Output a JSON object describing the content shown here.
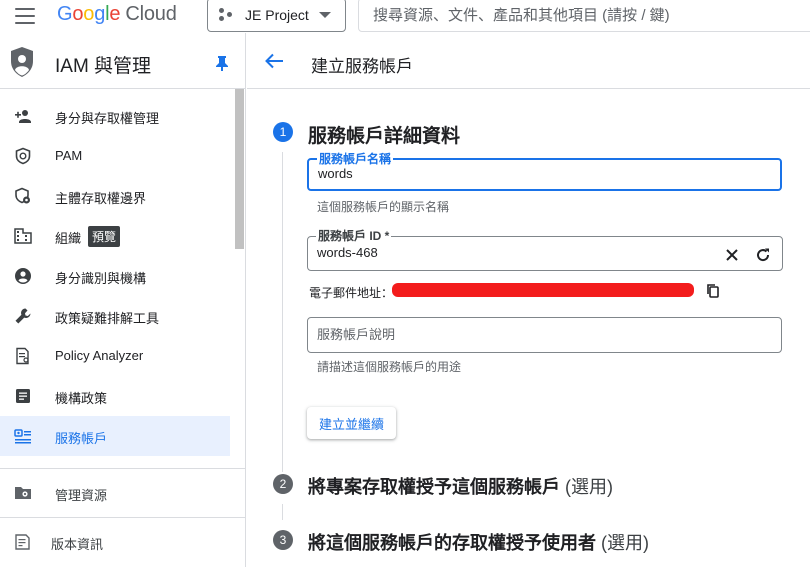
{
  "topbar": {
    "logo_letters": [
      "G",
      "o",
      "o",
      "g",
      "l",
      "e"
    ],
    "logo_product": "Cloud",
    "project_name": "JE Project",
    "search_placeholder": "搜尋資源、文件、產品和其他項目 (請按 / 鍵)"
  },
  "sidebar": {
    "title": "IAM 與管理",
    "items": [
      {
        "label": "身分與存取權管理",
        "icon": "person-add-icon"
      },
      {
        "label": "PAM",
        "icon": "shield-clock-icon"
      },
      {
        "label": "主體存取權邊界",
        "icon": "shield-gear-icon"
      },
      {
        "label": "組織",
        "icon": "domain-icon",
        "badge": "預覽"
      },
      {
        "label": "身分識別與機構",
        "icon": "account-circle-icon"
      },
      {
        "label": "政策疑難排解工具",
        "icon": "wrench-icon"
      },
      {
        "label": "Policy Analyzer",
        "icon": "policy-document-icon"
      },
      {
        "label": "機構政策",
        "icon": "list-document-icon"
      },
      {
        "label": "服務帳戶",
        "icon": "service-account-icon",
        "active": true
      }
    ],
    "manage_resources": "管理資源",
    "release_notes": "版本資訊"
  },
  "header": {
    "title": "建立服務帳戶"
  },
  "steps": [
    {
      "number": "1",
      "title": "服務帳戶詳細資料",
      "optional": ""
    },
    {
      "number": "2",
      "title": "將專案存取權授予這個服務帳戶",
      "optional": "(選用)"
    },
    {
      "number": "3",
      "title": "將這個服務帳戶的存取權授予使用者",
      "optional": "(選用)"
    }
  ],
  "form": {
    "name_label": "服務帳戶名稱",
    "name_value": "words",
    "name_hint": "這個服務帳戶的顯示名稱",
    "id_label": "服務帳戶 ID *",
    "id_value": "words-468",
    "email_label": "電子郵件地址：",
    "description_placeholder": "服務帳戶說明",
    "description_hint": "請描述這個服務帳戶的用途",
    "create_button": "建立並繼續"
  },
  "colors": {
    "accent": "#1a73e8",
    "active_bg": "#e8f0fe",
    "step_inactive": "#5f6368",
    "redaction": "#f21010"
  }
}
